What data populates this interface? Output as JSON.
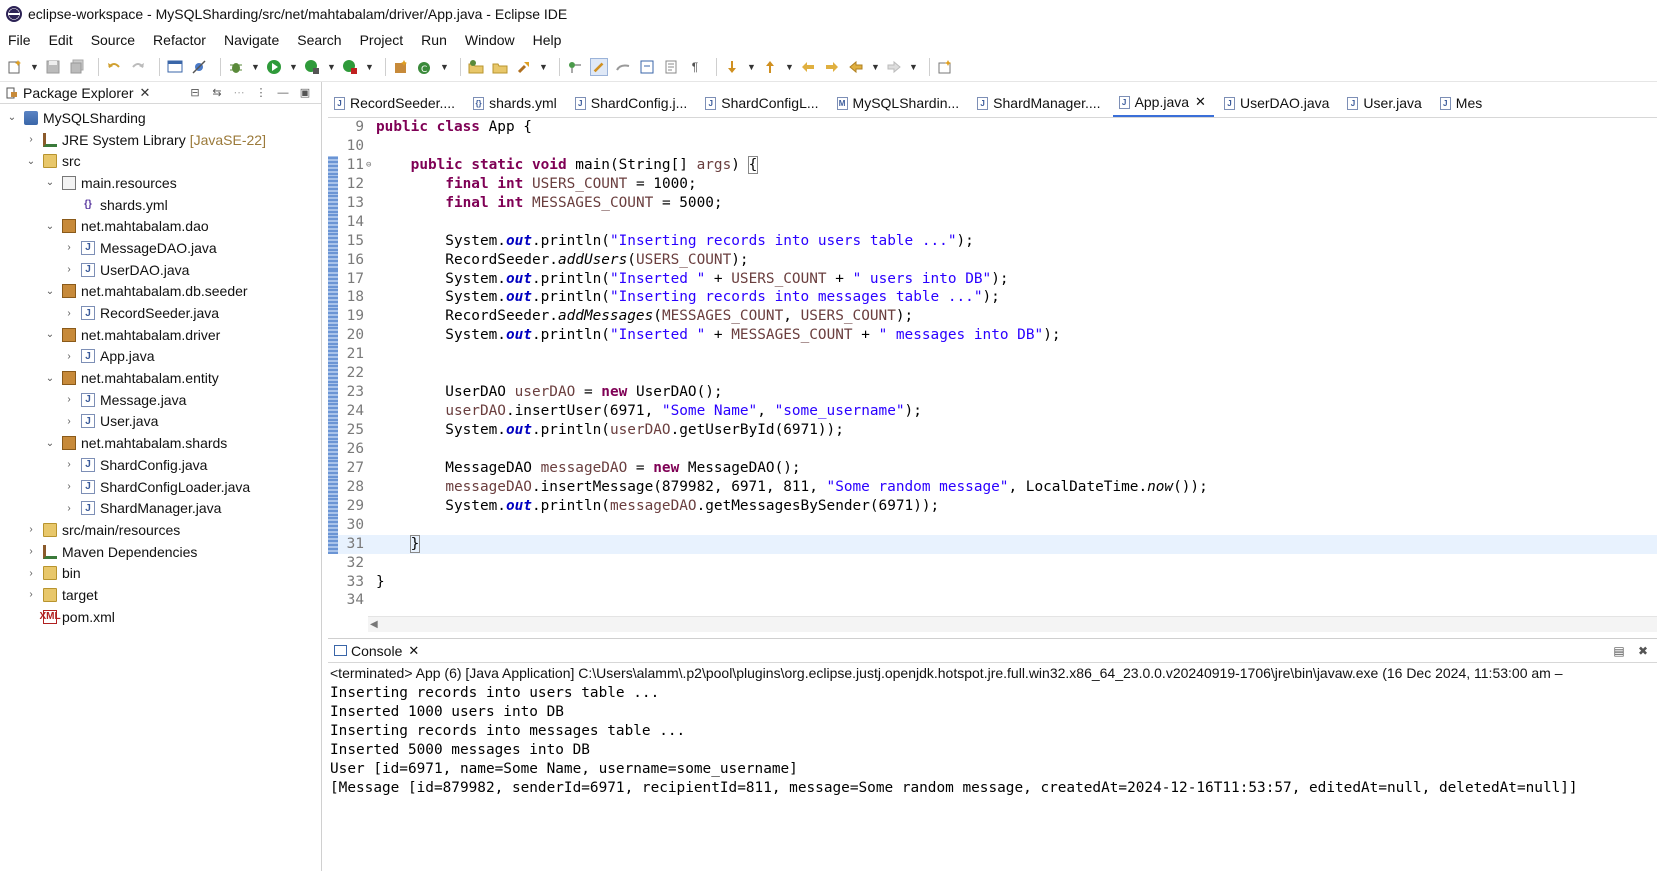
{
  "window": {
    "title": "eclipse-workspace - MySQLSharding/src/net/mahtabalam/driver/App.java - Eclipse IDE"
  },
  "menu": [
    "File",
    "Edit",
    "Source",
    "Refactor",
    "Navigate",
    "Search",
    "Project",
    "Run",
    "Window",
    "Help"
  ],
  "explorer": {
    "tab_label": "Package Explorer",
    "tree": [
      {
        "label": "MySQLSharding",
        "indent": 0,
        "chev": "⌄",
        "icon": "project"
      },
      {
        "label": "JRE System Library",
        "deco": "[JavaSE-22]",
        "indent": 1,
        "chev": "›",
        "icon": "lib"
      },
      {
        "label": "src",
        "indent": 1,
        "chev": "⌄",
        "icon": "folder"
      },
      {
        "label": "main.resources",
        "indent": 2,
        "chev": "⌄",
        "icon": "pkg-empty"
      },
      {
        "label": "shards.yml",
        "indent": 3,
        "chev": "",
        "icon": "yml"
      },
      {
        "label": "net.mahtabalam.dao",
        "indent": 2,
        "chev": "⌄",
        "icon": "pkg"
      },
      {
        "label": "MessageDAO.java",
        "indent": 3,
        "chev": "›",
        "icon": "java"
      },
      {
        "label": "UserDAO.java",
        "indent": 3,
        "chev": "›",
        "icon": "java"
      },
      {
        "label": "net.mahtabalam.db.seeder",
        "indent": 2,
        "chev": "⌄",
        "icon": "pkg"
      },
      {
        "label": "RecordSeeder.java",
        "indent": 3,
        "chev": "›",
        "icon": "java"
      },
      {
        "label": "net.mahtabalam.driver",
        "indent": 2,
        "chev": "⌄",
        "icon": "pkg"
      },
      {
        "label": "App.java",
        "indent": 3,
        "chev": "›",
        "icon": "java"
      },
      {
        "label": "net.mahtabalam.entity",
        "indent": 2,
        "chev": "⌄",
        "icon": "pkg"
      },
      {
        "label": "Message.java",
        "indent": 3,
        "chev": "›",
        "icon": "java"
      },
      {
        "label": "User.java",
        "indent": 3,
        "chev": "›",
        "icon": "java"
      },
      {
        "label": "net.mahtabalam.shards",
        "indent": 2,
        "chev": "⌄",
        "icon": "pkg"
      },
      {
        "label": "ShardConfig.java",
        "indent": 3,
        "chev": "›",
        "icon": "java"
      },
      {
        "label": "ShardConfigLoader.java",
        "indent": 3,
        "chev": "›",
        "icon": "java"
      },
      {
        "label": "ShardManager.java",
        "indent": 3,
        "chev": "›",
        "icon": "java"
      },
      {
        "label": "src/main/resources",
        "indent": 1,
        "chev": "›",
        "icon": "folder"
      },
      {
        "label": "Maven Dependencies",
        "indent": 1,
        "chev": "›",
        "icon": "lib"
      },
      {
        "label": "bin",
        "indent": 1,
        "chev": "›",
        "icon": "folder"
      },
      {
        "label": "target",
        "indent": 1,
        "chev": "›",
        "icon": "folder"
      },
      {
        "label": "pom.xml",
        "indent": 1,
        "chev": "",
        "icon": "xml"
      }
    ]
  },
  "editor": {
    "tabs": [
      {
        "label": "RecordSeeder....",
        "icon": "J"
      },
      {
        "label": "shards.yml",
        "icon": "{}"
      },
      {
        "label": "ShardConfig.j...",
        "icon": "J"
      },
      {
        "label": "ShardConfigL...",
        "icon": "J"
      },
      {
        "label": "MySQLShardin...",
        "icon": "M"
      },
      {
        "label": "ShardManager....",
        "icon": "J"
      },
      {
        "label": "App.java",
        "icon": "J",
        "active": true
      },
      {
        "label": "UserDAO.java",
        "icon": "J"
      },
      {
        "label": "User.java",
        "icon": "J"
      },
      {
        "label": "Mes",
        "icon": "J"
      }
    ],
    "lines": [
      {
        "n": "9",
        "code": "<span class=\"kw\">public</span> <span class=\"kw\">class</span> App {"
      },
      {
        "n": "10",
        "code": ""
      },
      {
        "n": "11",
        "fold": true,
        "mark": true,
        "code": "    <span class=\"kw\">public</span> <span class=\"kw\">static</span> <span class=\"kw\">void</span> main(String[] <span class=\"var\">args</span>) <span class=\"brk\">{</span>"
      },
      {
        "n": "12",
        "mark": true,
        "code": "        <span class=\"kw\">final</span> <span class=\"kw\">int</span> <span class=\"var\">USERS_COUNT</span> = 1000;"
      },
      {
        "n": "13",
        "mark": true,
        "code": "        <span class=\"kw\">final</span> <span class=\"kw\">int</span> <span class=\"var\">MESSAGES_COUNT</span> = 5000;"
      },
      {
        "n": "14",
        "mark": true,
        "code": ""
      },
      {
        "n": "15",
        "mark": true,
        "code": "        System.<span class=\"fld\">out</span>.println(<span class=\"str\">\"Inserting records into users table ...\"</span>);"
      },
      {
        "n": "16",
        "mark": true,
        "code": "        RecordSeeder.<span class=\"stm\">addUsers</span>(<span class=\"var\">USERS_COUNT</span>);"
      },
      {
        "n": "17",
        "mark": true,
        "code": "        System.<span class=\"fld\">out</span>.println(<span class=\"str\">\"Inserted \"</span> + <span class=\"var\">USERS_COUNT</span> + <span class=\"str\">\" users into DB\"</span>);"
      },
      {
        "n": "18",
        "mark": true,
        "code": "        System.<span class=\"fld\">out</span>.println(<span class=\"str\">\"Inserting records into messages table ...\"</span>);"
      },
      {
        "n": "19",
        "mark": true,
        "code": "        RecordSeeder.<span class=\"stm\">addMessages</span>(<span class=\"var\">MESSAGES_COUNT</span>, <span class=\"var\">USERS_COUNT</span>);"
      },
      {
        "n": "20",
        "mark": true,
        "code": "        System.<span class=\"fld\">out</span>.println(<span class=\"str\">\"Inserted \"</span> + <span class=\"var\">MESSAGES_COUNT</span> + <span class=\"str\">\" messages into DB\"</span>);"
      },
      {
        "n": "21",
        "mark": true,
        "code": ""
      },
      {
        "n": "22",
        "mark": true,
        "code": ""
      },
      {
        "n": "23",
        "mark": true,
        "code": "        UserDAO <span class=\"var\">userDAO</span> = <span class=\"kw\">new</span> UserDAO();"
      },
      {
        "n": "24",
        "mark": true,
        "code": "        <span class=\"var\">userDAO</span>.insertUser(6971, <span class=\"str\">\"Some Name\"</span>, <span class=\"str\">\"some_username\"</span>);"
      },
      {
        "n": "25",
        "mark": true,
        "code": "        System.<span class=\"fld\">out</span>.println(<span class=\"var\">userDAO</span>.getUserById(6971));"
      },
      {
        "n": "26",
        "mark": true,
        "code": ""
      },
      {
        "n": "27",
        "mark": true,
        "code": "        MessageDAO <span class=\"var\">messageDAO</span> = <span class=\"kw\">new</span> MessageDAO();"
      },
      {
        "n": "28",
        "mark": true,
        "code": "        <span class=\"var\">messageDAO</span>.insertMessage(879982, 6971, 811, <span class=\"str\">\"Some random message\"</span>, LocalDateTime.<span class=\"stm\">now</span>());"
      },
      {
        "n": "29",
        "mark": true,
        "code": "        System.<span class=\"fld\">out</span>.println(<span class=\"var\">messageDAO</span>.getMessagesBySender(6971));"
      },
      {
        "n": "30",
        "mark": true,
        "code": ""
      },
      {
        "n": "31",
        "mark": true,
        "current": true,
        "code": "    <span class=\"brk\">}</span><span class=\"caret\"></span>"
      },
      {
        "n": "32",
        "code": ""
      },
      {
        "n": "33",
        "code": "}"
      },
      {
        "n": "34",
        "code": ""
      }
    ]
  },
  "console": {
    "tab_label": "Console",
    "status": "<terminated> App (6) [Java Application] C:\\Users\\alamm\\.p2\\pool\\plugins\\org.eclipse.justj.openjdk.hotspot.jre.full.win32.x86_64_23.0.0.v20240919-1706\\jre\\bin\\javaw.exe  (16 Dec 2024, 11:53:00 am –",
    "output": [
      "Inserting records into users table ...",
      "Inserted 1000 users into DB",
      "Inserting records into messages table ...",
      "Inserted 5000 messages into DB",
      "User [id=6971, name=Some Name, username=some_username]",
      "[Message [id=879982, senderId=6971, recipientId=811, message=Some random message, createdAt=2024-12-16T11:53:57, editedAt=null, deletedAt=null]]"
    ]
  }
}
